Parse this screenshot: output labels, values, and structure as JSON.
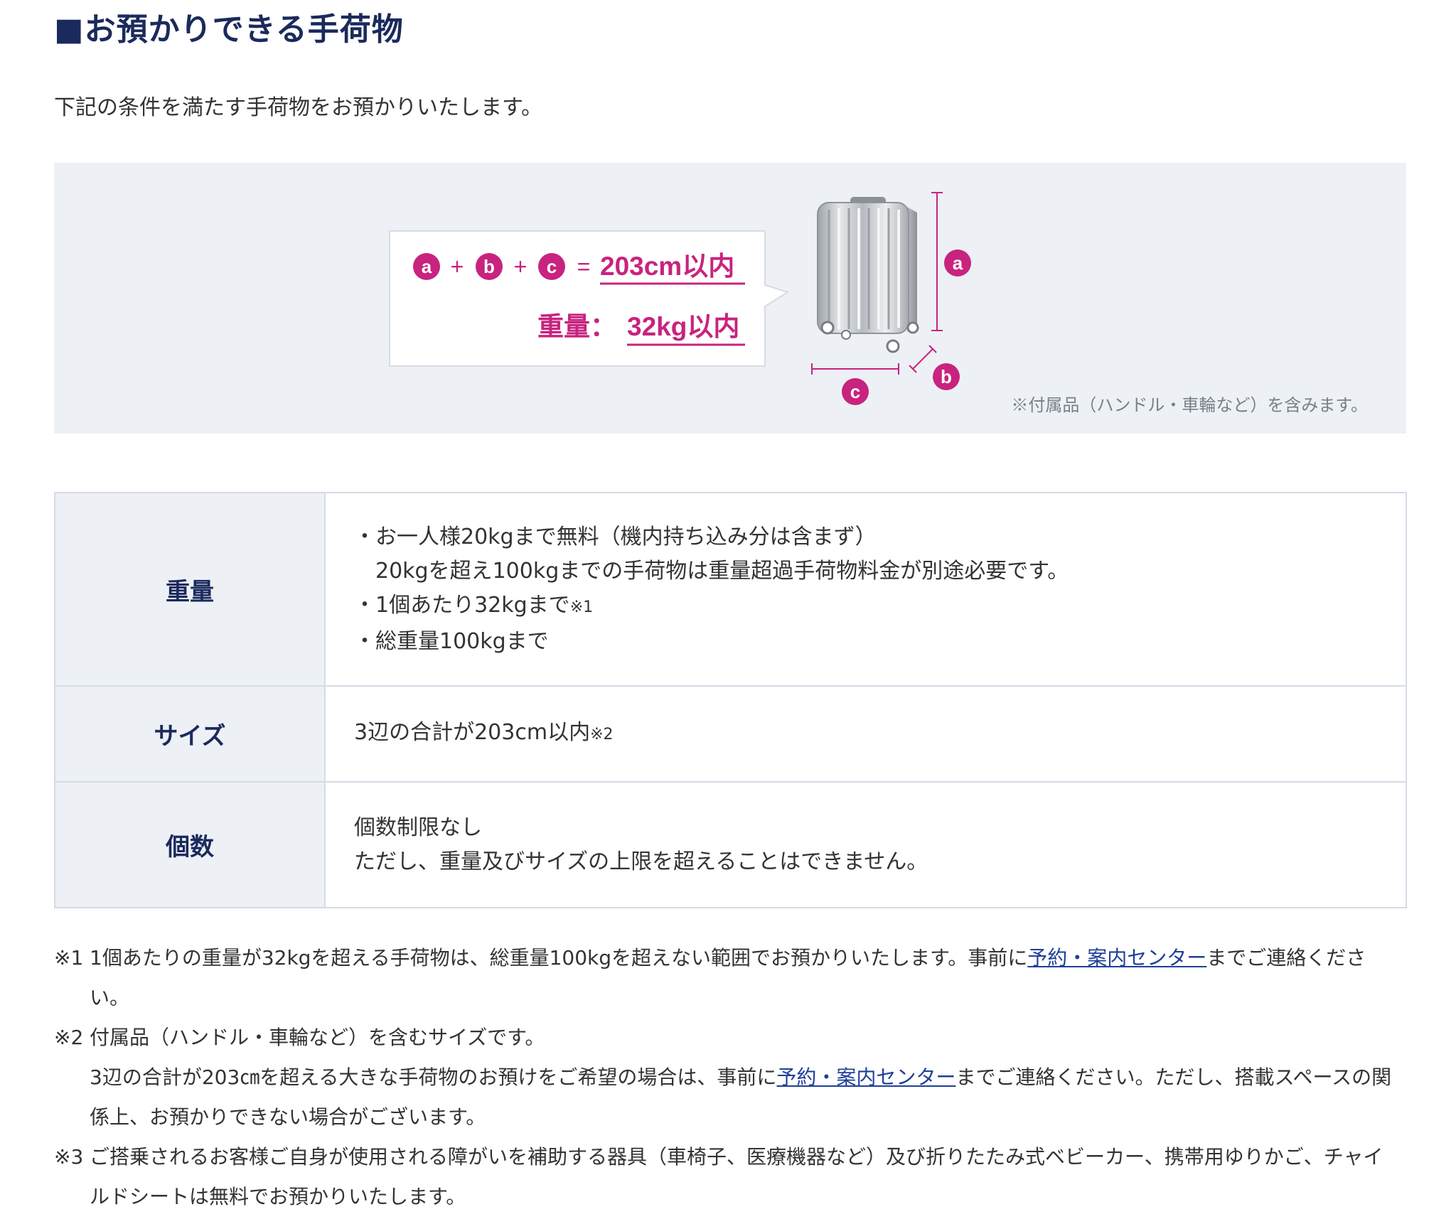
{
  "heading": "■お預かりできる手荷物",
  "intro": "下記の条件を満たす手荷物をお預かりいたします。",
  "diagram": {
    "label_a": "a",
    "label_b": "b",
    "label_c": "c",
    "plus1": "+",
    "plus2": "+",
    "equals": "=",
    "size_limit": "203cm以内",
    "weight_label": "重量：",
    "weight_limit": "32kg以内",
    "note": "※付属品（ハンドル・車輪など）を含みます。",
    "accent_color": "#c8237e",
    "dim_line_color": "#c8237e"
  },
  "table": {
    "rows": [
      {
        "header": "重量",
        "lines": [
          "・お一人様20kgまで無料（機内持ち込み分は含まず）",
          "20kgを超え100kgまでの手荷物は重量超過手荷物料金が別途必要です。",
          "・1個あたり32kgまで",
          "・総重量100kgまで"
        ],
        "line3_note": "※1"
      },
      {
        "header": "サイズ",
        "text": "3辺の合計が203cm以内",
        "note": "※2"
      },
      {
        "header": "個数",
        "lines": [
          "個数制限なし",
          "ただし、重量及びサイズの上限を超えることはできません。"
        ]
      }
    ]
  },
  "notes": {
    "n1": {
      "mark": "※1",
      "text_before": "1個あたりの重量が32kgを超える手荷物は、総重量100kgを超えない範囲でお預かりいたします。事前に",
      "link": "予約・案内センター",
      "text_after": "までご連絡くださ",
      "cont": "い。"
    },
    "n2": {
      "mark": "※2",
      "line1": "付属品（ハンドル・車輪など）を含むサイズです。",
      "text_before": "3辺の合計が203㎝を超える大きな手荷物のお預けをご希望の場合は、事前に",
      "link": "予約・案内センター",
      "text_after": "までご連絡ください。ただし、搭載スペースの関",
      "cont": "係上、お預かりできない場合がございます。"
    },
    "n3": {
      "mark": "※3",
      "line1": "ご搭乗されるお客様ご自身が使用される障がいを補助する器具（車椅子、医療機器など）及び折りたたみ式ベビーカー、携帯用ゆりかご、チャイ",
      "cont": "ルドシートは無料でお預かりいたします。"
    }
  }
}
